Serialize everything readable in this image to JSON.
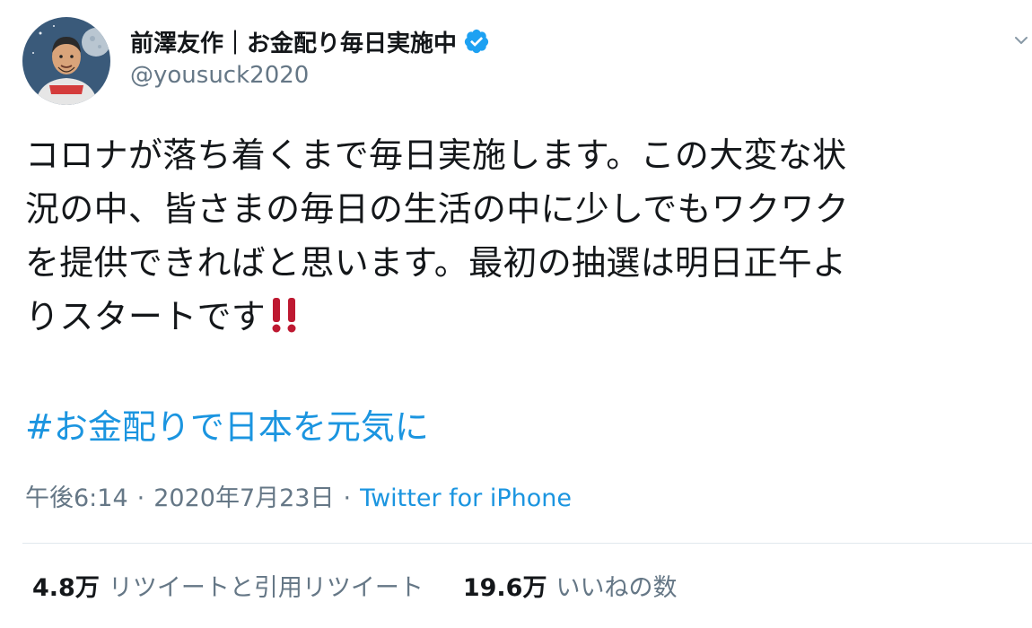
{
  "author": {
    "display_name": "前澤友作｜お金配り毎日実施中",
    "handle": "@yousuck2020",
    "verified": true
  },
  "tweet": {
    "text": "コロナが落ち着くまで毎日実施します。この大変な状\n況の中、皆さまの毎日の生活の中に少しでもワクワク\nを提供できればと思います。最初の抽選は明日正午よ\nりスタートです",
    "emoji": "‼️",
    "hashtag": "#お金配りで日本を元気に"
  },
  "meta": {
    "time": "午後6:14",
    "separator": "·",
    "date": "2020年7月23日",
    "source": "Twitter for iPhone"
  },
  "stats": {
    "retweets_count": "4.8万",
    "retweets_label": "リツイートと引用リツイート",
    "likes_count": "19.6万",
    "likes_label": "いいねの数"
  },
  "colors": {
    "link": "#1b95e0",
    "secondary_text": "#657786",
    "primary_text": "#14171a",
    "verified": "#1da1f2",
    "emoji_red": "#be1931",
    "divider": "#e1e8ed"
  },
  "icons": {
    "verified": "verified-badge-icon",
    "menu": "chevron-down-icon",
    "emoji": "double-exclamation-icon"
  }
}
